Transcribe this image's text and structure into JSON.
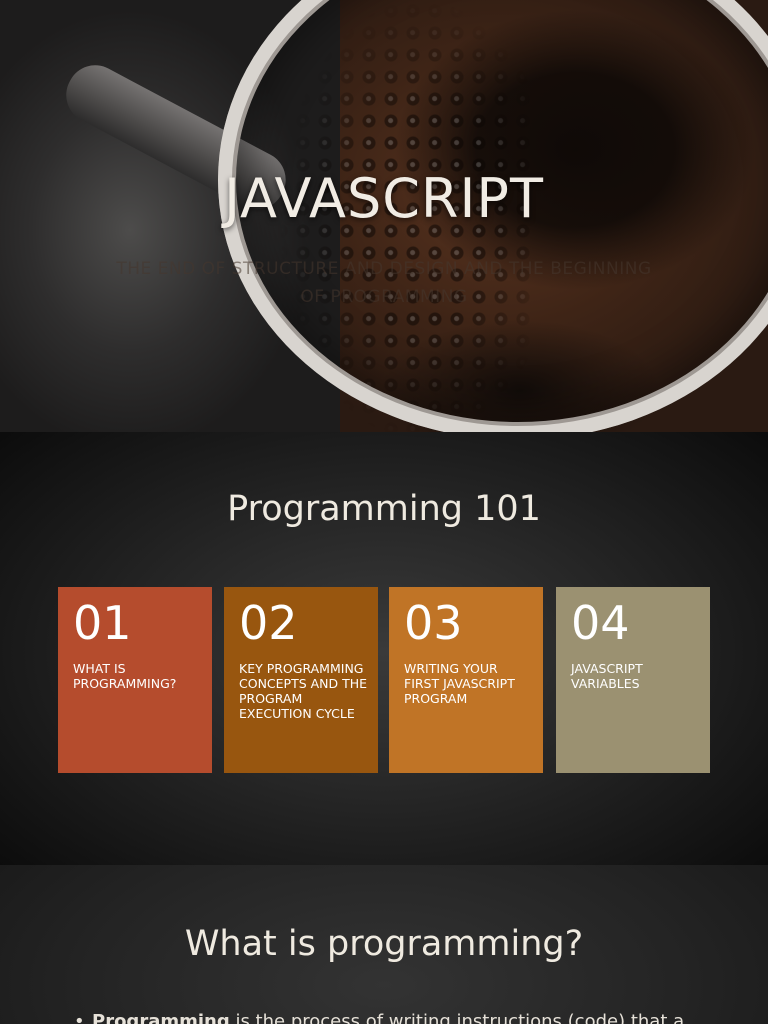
{
  "slide1": {
    "title": "JAVASCRIPT",
    "subtitle": "THE END OF STRUCTURE AND DESIGN AND THE BEGINNING OF PROGRAMMING"
  },
  "slide2": {
    "title": "Programming 101",
    "tiles": [
      {
        "number": "01",
        "label": "WHAT IS PROGRAMMING?",
        "color": "#b54c2d"
      },
      {
        "number": "02",
        "label": "KEY PROGRAMMING CONCEPTS AND THE PROGRAM EXECUTION CYCLE",
        "color": "#98560f"
      },
      {
        "number": "03",
        "label": "WRITING YOUR FIRST JAVASCRIPT PROGRAM",
        "color": "#c07426"
      },
      {
        "number": "04",
        "label": "JAVASCRIPT VARIABLES",
        "color": "#9b9171"
      }
    ]
  },
  "slide3": {
    "title": "What is programming?",
    "bullet_term": "Programming",
    "bullet_text": " is the process of writing instructions (code) that a"
  }
}
